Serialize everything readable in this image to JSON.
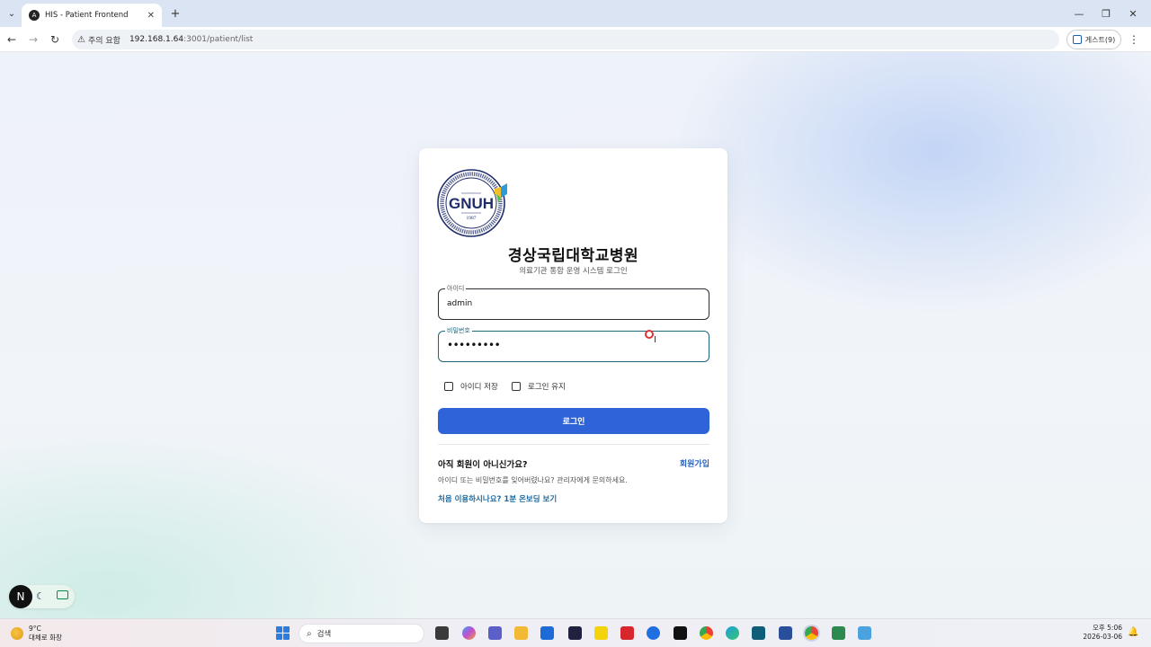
{
  "browser": {
    "tab_title": "HIS - Patient Frontend",
    "tab_favicon": "A",
    "security_warning": "주의 요함",
    "url_host": "192.168.1.64",
    "url_path": ":3001/patient/list",
    "profile_label": "게스트(9)"
  },
  "login": {
    "logo_text": "GNUH",
    "logo_year": "1987",
    "logo_ring_text": "GYEONGSANG NATIONAL UNIVERSITY HOSPITAL",
    "logo_ring_korean": "경상국립대학교병원",
    "hospital_name": "경상국립대학교병원",
    "subtitle": "의료기관 통합 운영 시스템 로그인",
    "id_label": "아이디",
    "id_value": "admin",
    "pw_label": "비밀번호",
    "pw_value": "•••••••••",
    "remember_id": "아이디 저장",
    "keep_login": "로그인 유지",
    "login_button": "로그인",
    "not_member": "아직 회원이 아니신가요?",
    "signup_link": "회원가입",
    "help_text": "아이디 또는 비밀번호를 잊어버렸나요? 관리자에게 문의하세요.",
    "onboarding_link": "처음 이용하시나요? 1분 온보딩 보기"
  },
  "devtools": {
    "badge": "N"
  },
  "taskbar": {
    "temperature": "9°C",
    "weather_desc": "대체로 화창",
    "search_placeholder": "검색",
    "time": "오후 5:06",
    "date": "2026-03-06"
  },
  "colors": {
    "primary": "#2f63d8",
    "focus": "#20667a",
    "link": "#2a63c0",
    "logo_navy": "#1f2d6b"
  }
}
